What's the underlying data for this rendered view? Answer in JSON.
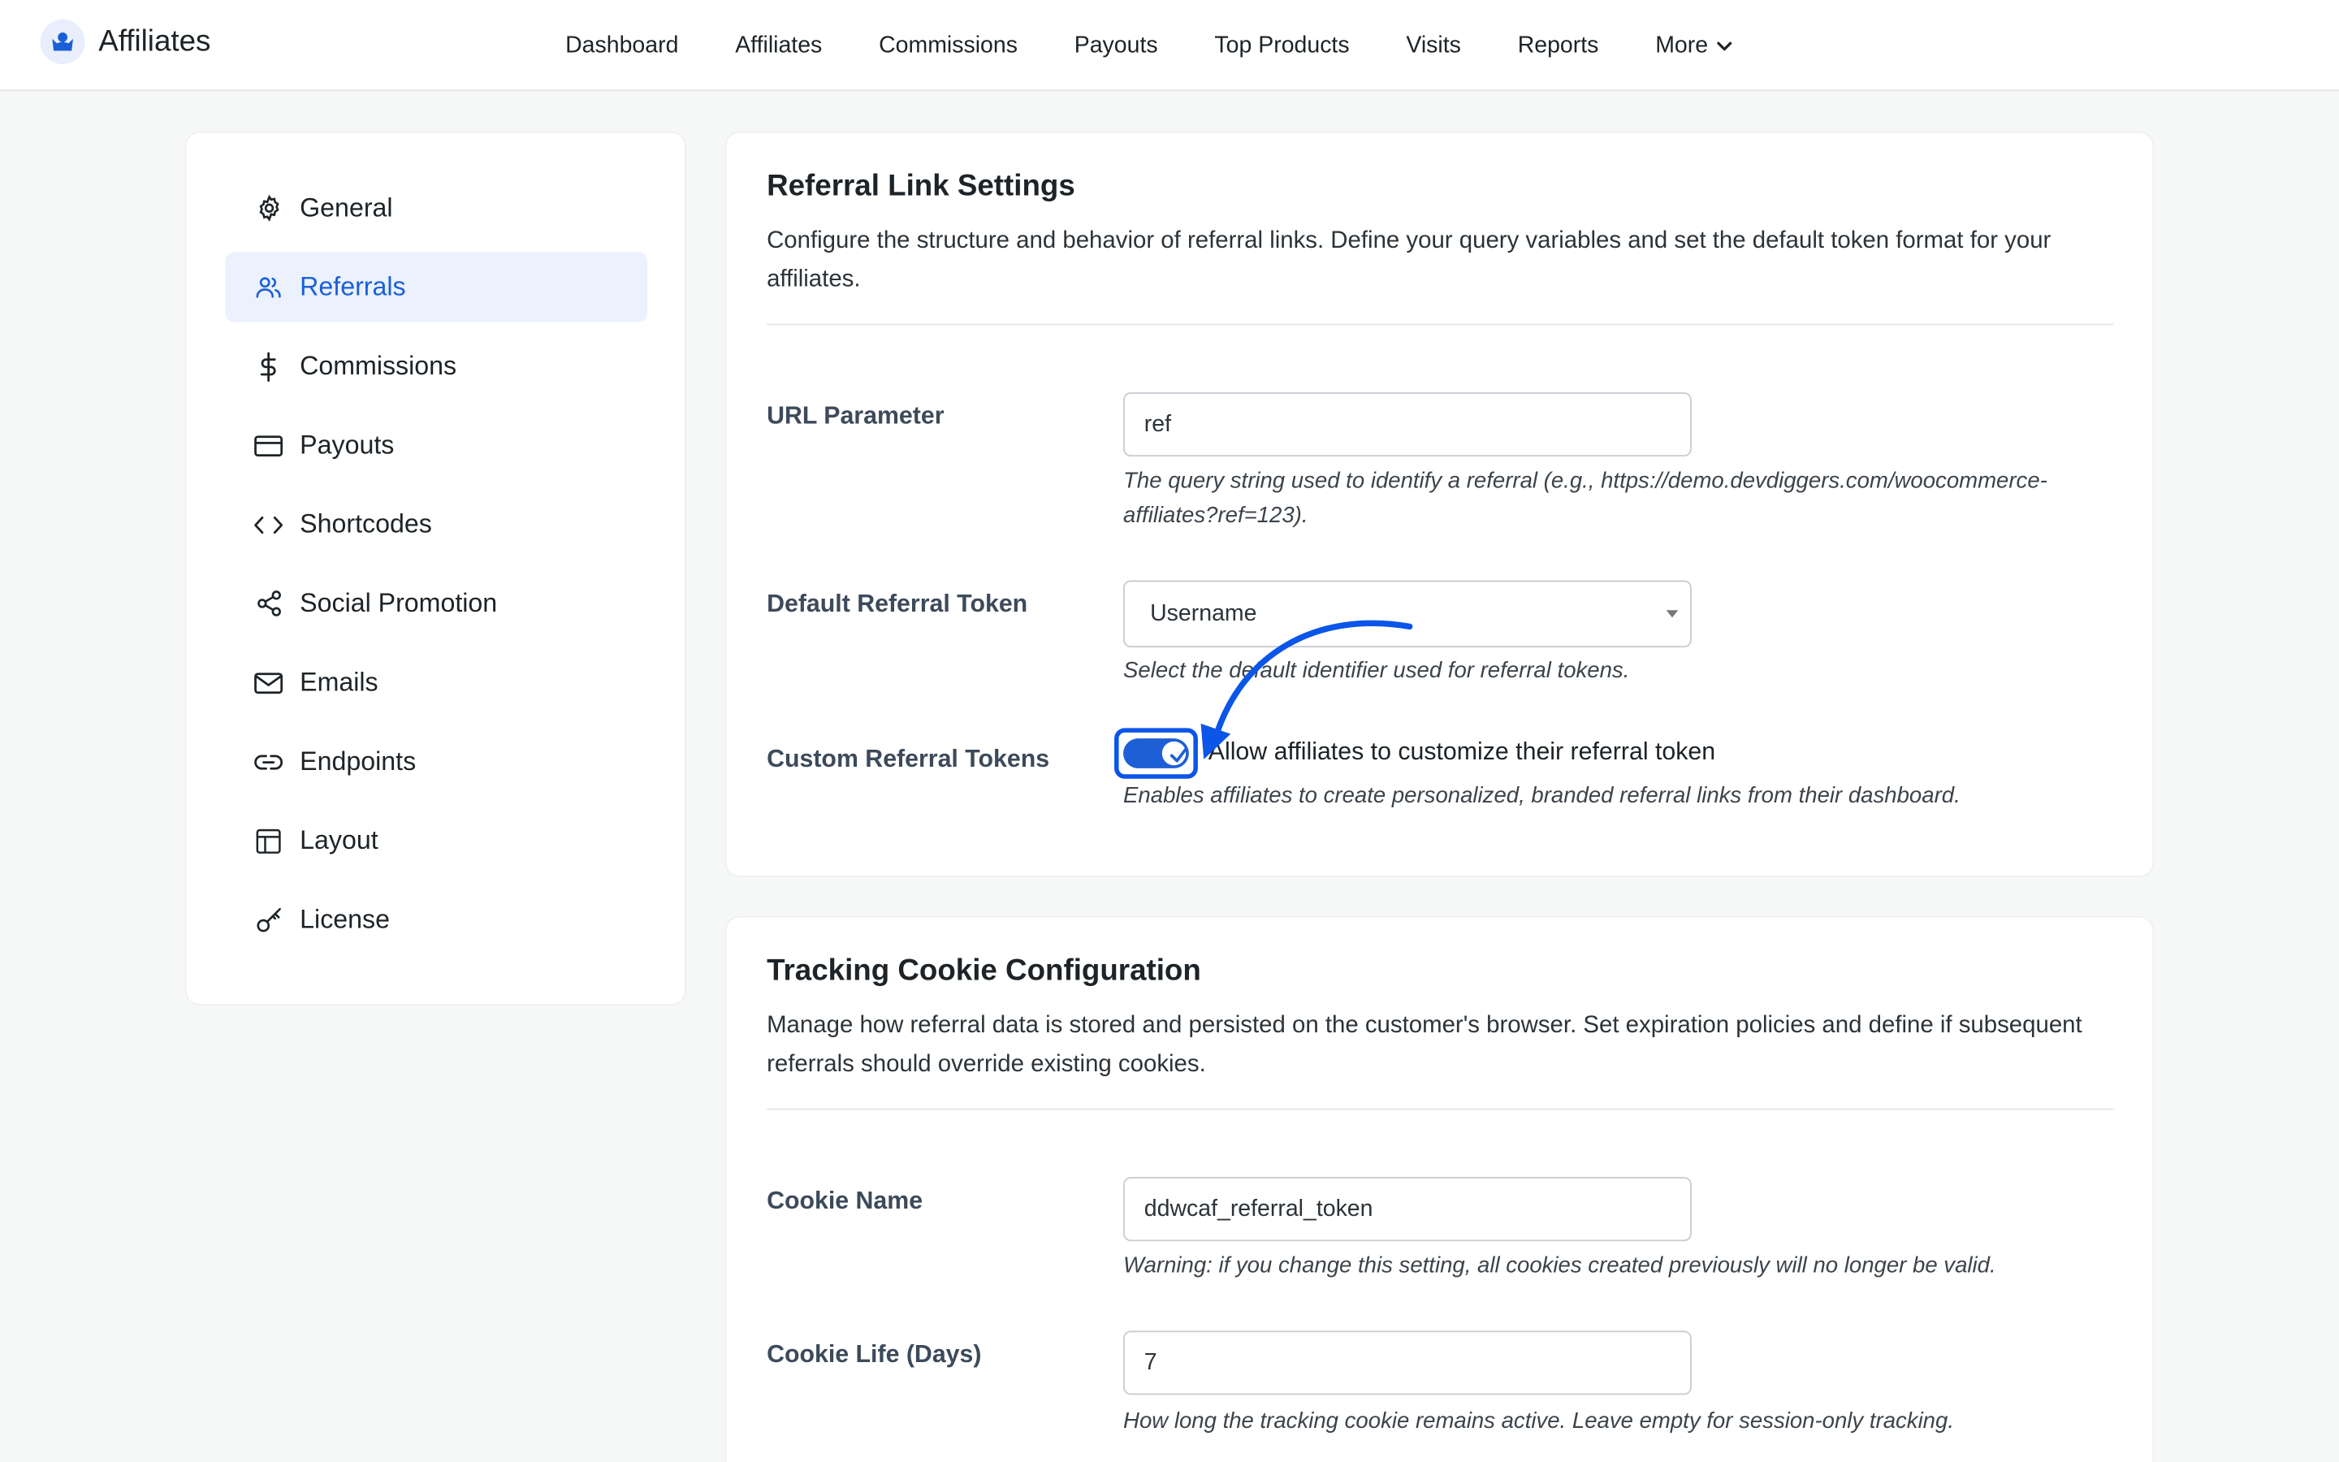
{
  "header": {
    "brand": "Affiliates",
    "nav": [
      "Dashboard",
      "Affiliates",
      "Commissions",
      "Payouts",
      "Top Products",
      "Visits",
      "Reports",
      "More"
    ]
  },
  "sidebar": {
    "items": [
      {
        "label": "General",
        "icon": "gear-icon"
      },
      {
        "label": "Referrals",
        "icon": "users-icon",
        "active": true
      },
      {
        "label": "Commissions",
        "icon": "dollar-icon"
      },
      {
        "label": "Payouts",
        "icon": "credit-card-icon"
      },
      {
        "label": "Shortcodes",
        "icon": "code-icon"
      },
      {
        "label": "Social Promotion",
        "icon": "share-icon"
      },
      {
        "label": "Emails",
        "icon": "mail-icon"
      },
      {
        "label": "Endpoints",
        "icon": "link-icon"
      },
      {
        "label": "Layout",
        "icon": "layout-icon"
      },
      {
        "label": "License",
        "icon": "key-icon"
      }
    ]
  },
  "referral_settings": {
    "title": "Referral Link Settings",
    "description": "Configure the structure and behavior of referral links. Define your query variables and set the default token format for your affiliates.",
    "url_parameter": {
      "label": "URL Parameter",
      "value": "ref",
      "help": "The query string used to identify a referral (e.g., https://demo.devdiggers.com/woocommerce-affiliates?ref=123)."
    },
    "default_token": {
      "label": "Default Referral Token",
      "value": "Username",
      "help": "Select the default identifier used for referral tokens."
    },
    "custom_tokens": {
      "label": "Custom Referral Tokens",
      "toggle_label": "Allow affiliates to customize their referral token",
      "enabled": true,
      "help": "Enables affiliates to create personalized, branded referral links from their dashboard."
    }
  },
  "cookie_settings": {
    "title": "Tracking Cookie Configuration",
    "description": "Manage how referral data is stored and persisted on the customer's browser. Set expiration policies and define if subsequent referrals should override existing cookies.",
    "cookie_name": {
      "label": "Cookie Name",
      "value": "ddwcaf_referral_token",
      "help": "Warning: if you change this setting, all cookies created previously will no longer be valid."
    },
    "cookie_life": {
      "label": "Cookie Life (Days)",
      "value": "7",
      "help": "How long the tracking cookie remains active. Leave empty for session-only tracking."
    }
  },
  "colors": {
    "accent": "#1a5fd7",
    "active_bg": "#ebf1fd",
    "annotation": "#0b55e8"
  }
}
